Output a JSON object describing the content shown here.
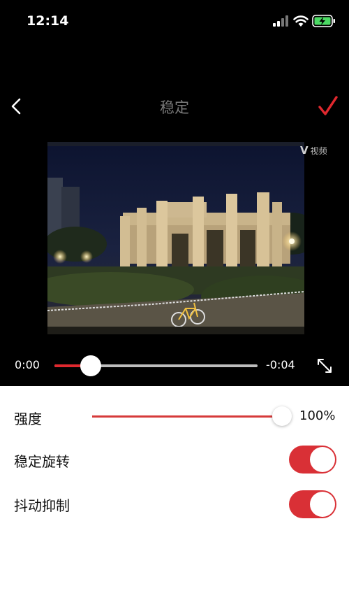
{
  "status_bar": {
    "time": "12:14"
  },
  "nav": {
    "title": "稳定"
  },
  "video": {
    "watermark_text": "视频",
    "watermark_logo": "V"
  },
  "playback": {
    "current_time": "0:00",
    "remaining_time": "-0:04",
    "progress": 0.18
  },
  "settings": {
    "strength": {
      "label": "强度",
      "value_text": "100%",
      "value": 1.0
    },
    "stabilize_rotation": {
      "label": "稳定旋转",
      "enabled": true
    },
    "shake_suppression": {
      "label": "抖动抑制",
      "enabled": true
    }
  },
  "colors": {
    "accent": "#e0282e",
    "title_gray": "#7a7a7a",
    "panel_bg": "#ffffff"
  },
  "icons": [
    "signal-icon",
    "wifi-icon",
    "battery-charging-icon",
    "back-icon",
    "checkmark-icon",
    "fullscreen-icon"
  ]
}
